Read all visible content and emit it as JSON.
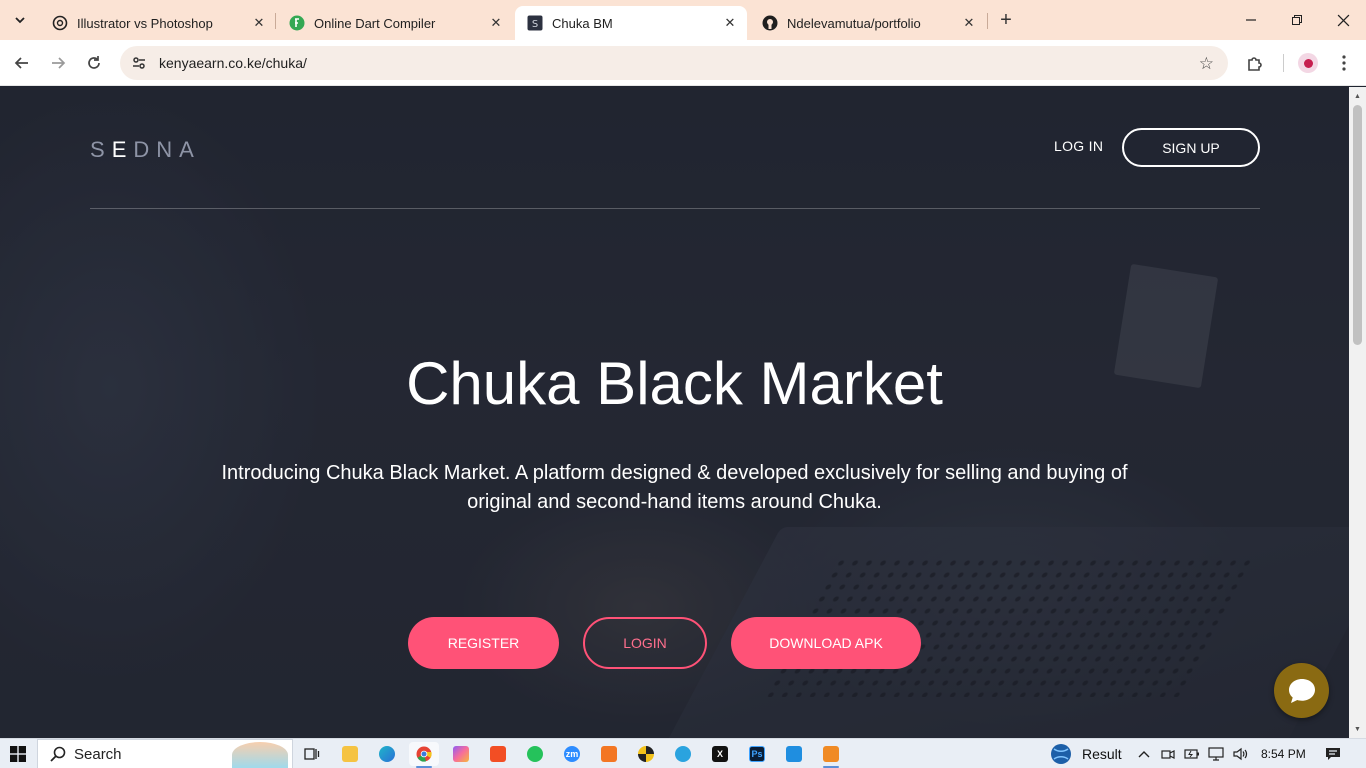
{
  "browser": {
    "tabs": [
      {
        "title": "Illustrator vs Photoshop",
        "icon": "openai-icon",
        "active": false
      },
      {
        "title": "Online Dart Compiler",
        "icon": "dart-compiler-icon",
        "active": false
      },
      {
        "title": "Chuka BM",
        "icon": "s-favicon-icon",
        "active": true
      },
      {
        "title": "Ndelevamutua/portfolio",
        "icon": "github-icon",
        "active": false
      }
    ],
    "url": "kenyaearn.co.ke/chuka/"
  },
  "page": {
    "brand": {
      "pre": "S",
      "mid": "E",
      "post": "DNA"
    },
    "nav": {
      "login": "LOG IN",
      "signup": "SIGN UP"
    },
    "hero": {
      "title": "Chuka Black Market",
      "subtitle_line1": "Introducing Chuka Black Market. A platform designed & developed exclusively for selling and buying of",
      "subtitle_line2": "original and second-hand items around Chuka."
    },
    "buttons": {
      "register": "REGISTER",
      "login": "LOGIN",
      "download": "DOWNLOAD APK"
    },
    "colors": {
      "accent": "#ff5277",
      "chat": "#8a6a12",
      "background": "#262b37"
    }
  },
  "taskbar": {
    "search_label": "Search",
    "weather_label": "Result",
    "time": "8:54 PM"
  }
}
